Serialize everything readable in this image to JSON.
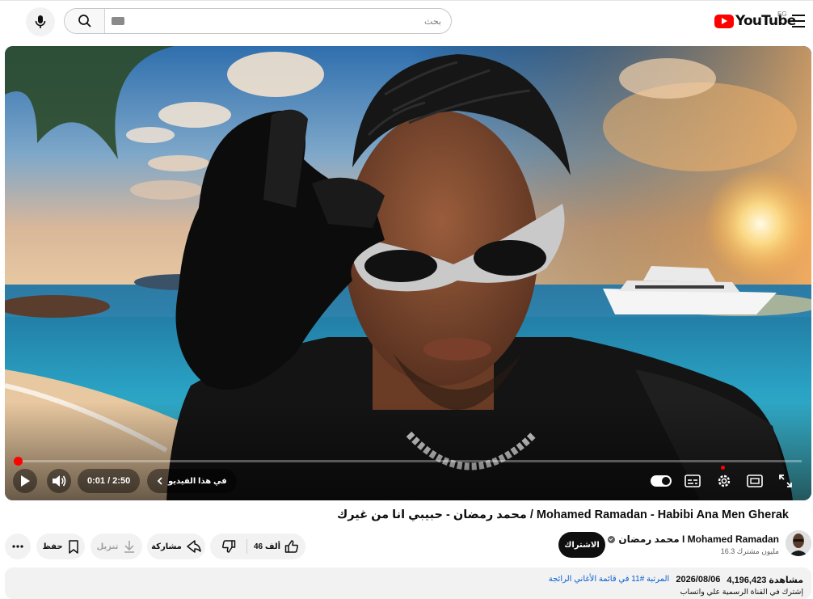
{
  "header": {
    "logo_text": "YouTube",
    "region": "EG",
    "search_placeholder": "بحث"
  },
  "player": {
    "time_current": "0:01",
    "time_total": "2:50",
    "time_display": "0:01 / 2:50",
    "chapter_label": "في هذا الفيديو",
    "progress_fraction": 0.004
  },
  "video": {
    "title": "محمد رمضان - حبيبي انا من غيرك / Mohamed Ramadan - Habibi Ana Men Gherak"
  },
  "channel": {
    "name": "محمد رمضان I Mohamed Ramadan",
    "subscribers": "16.3 مليون مشترك",
    "subscribe_label": "الاشتراك"
  },
  "actions": {
    "like_count": "46 ألف",
    "share_label": "مشاركة",
    "download_label": "تنزيل",
    "save_label": "حفظ"
  },
  "description": {
    "views": "4,196,423 مشاهدة",
    "date": "2026/08/06",
    "trending": "المرتبة #11 في قائمة الأغاني الرائجة",
    "text": "إشترك في القناة الرسمية علي واتساب"
  },
  "icons": [
    "mic-icon",
    "search-icon",
    "keyboard-icon",
    "youtube-logo-icon",
    "menu-icon",
    "play-icon",
    "volume-icon",
    "chevron-icon",
    "autoplay-toggle-icon",
    "subtitles-icon",
    "settings-icon",
    "miniplayer-icon",
    "fullscreen-icon",
    "like-icon",
    "dislike-icon",
    "share-icon",
    "download-icon",
    "save-icon",
    "more-icon",
    "verified-icon"
  ],
  "colors": {
    "brand": "#ff0000",
    "link": "#065fd4",
    "chip": "#f2f2f2"
  }
}
